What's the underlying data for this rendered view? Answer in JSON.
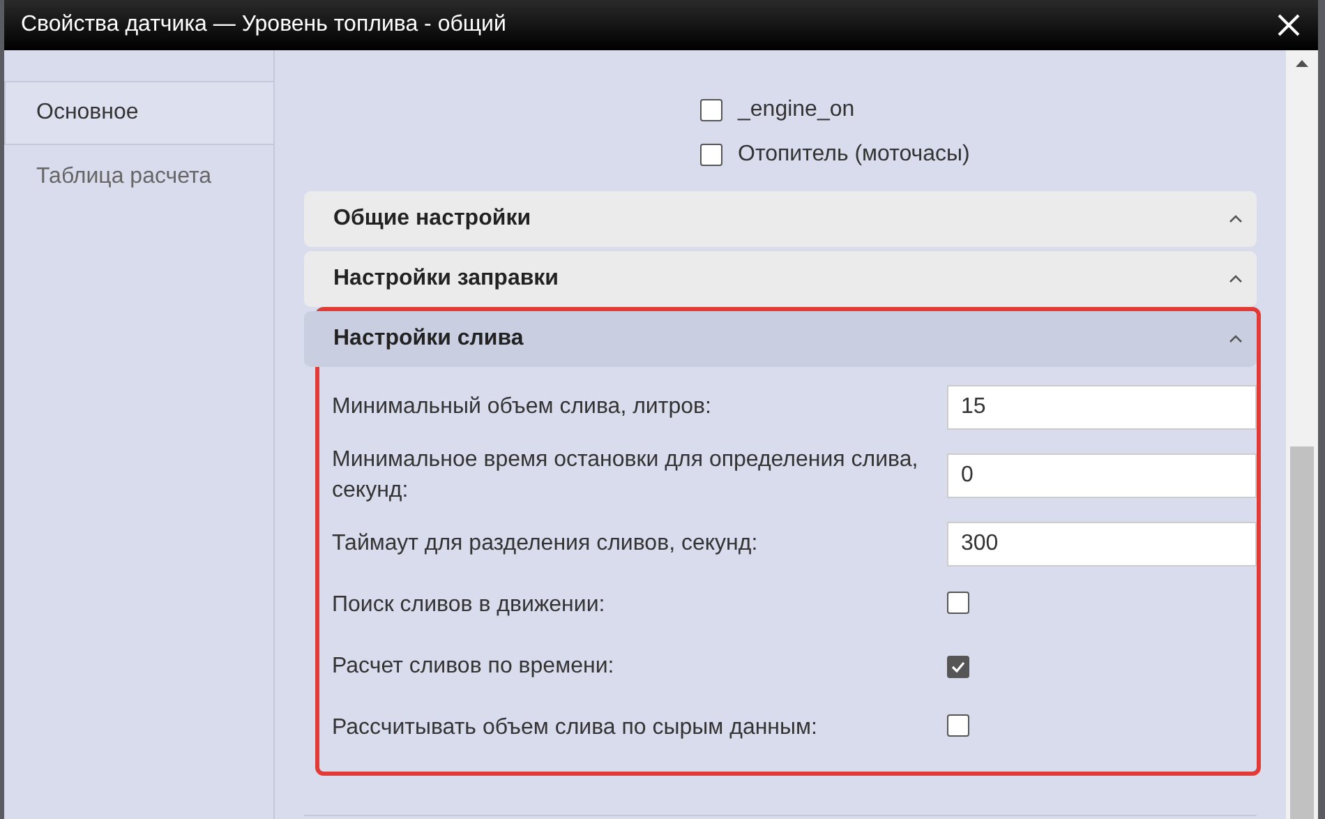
{
  "window": {
    "title": "Свойства датчика — Уровень топлива - общий"
  },
  "sidebar": {
    "items": [
      {
        "label": "Основное",
        "selected": true
      },
      {
        "label": "Таблица расчета",
        "selected": false
      }
    ]
  },
  "sensors": [
    {
      "label": "_engine_on",
      "checked": false
    },
    {
      "label": "Отопитель (моточасы)",
      "checked": false
    }
  ],
  "sections": [
    {
      "title": "Общие настройки",
      "active": false
    },
    {
      "title": "Настройки заправки",
      "active": false
    },
    {
      "title": "Настройки слива",
      "active": true,
      "highlighted": true,
      "fields": [
        {
          "kind": "input",
          "label": "Минимальный объем слива, литров:",
          "value": "15"
        },
        {
          "kind": "input",
          "label": "Минимальное время остановки для определения слива, секунд:",
          "value": "0"
        },
        {
          "kind": "input",
          "label": "Таймаут для разделения сливов, секунд:",
          "value": "300"
        },
        {
          "kind": "checkbox",
          "label": "Поиск сливов в движении:",
          "checked": false
        },
        {
          "kind": "checkbox",
          "label": "Расчет сливов по времени:",
          "checked": true
        },
        {
          "kind": "checkbox",
          "label": "Рассчитывать объем слива по сырым данным:",
          "checked": false
        }
      ]
    }
  ]
}
